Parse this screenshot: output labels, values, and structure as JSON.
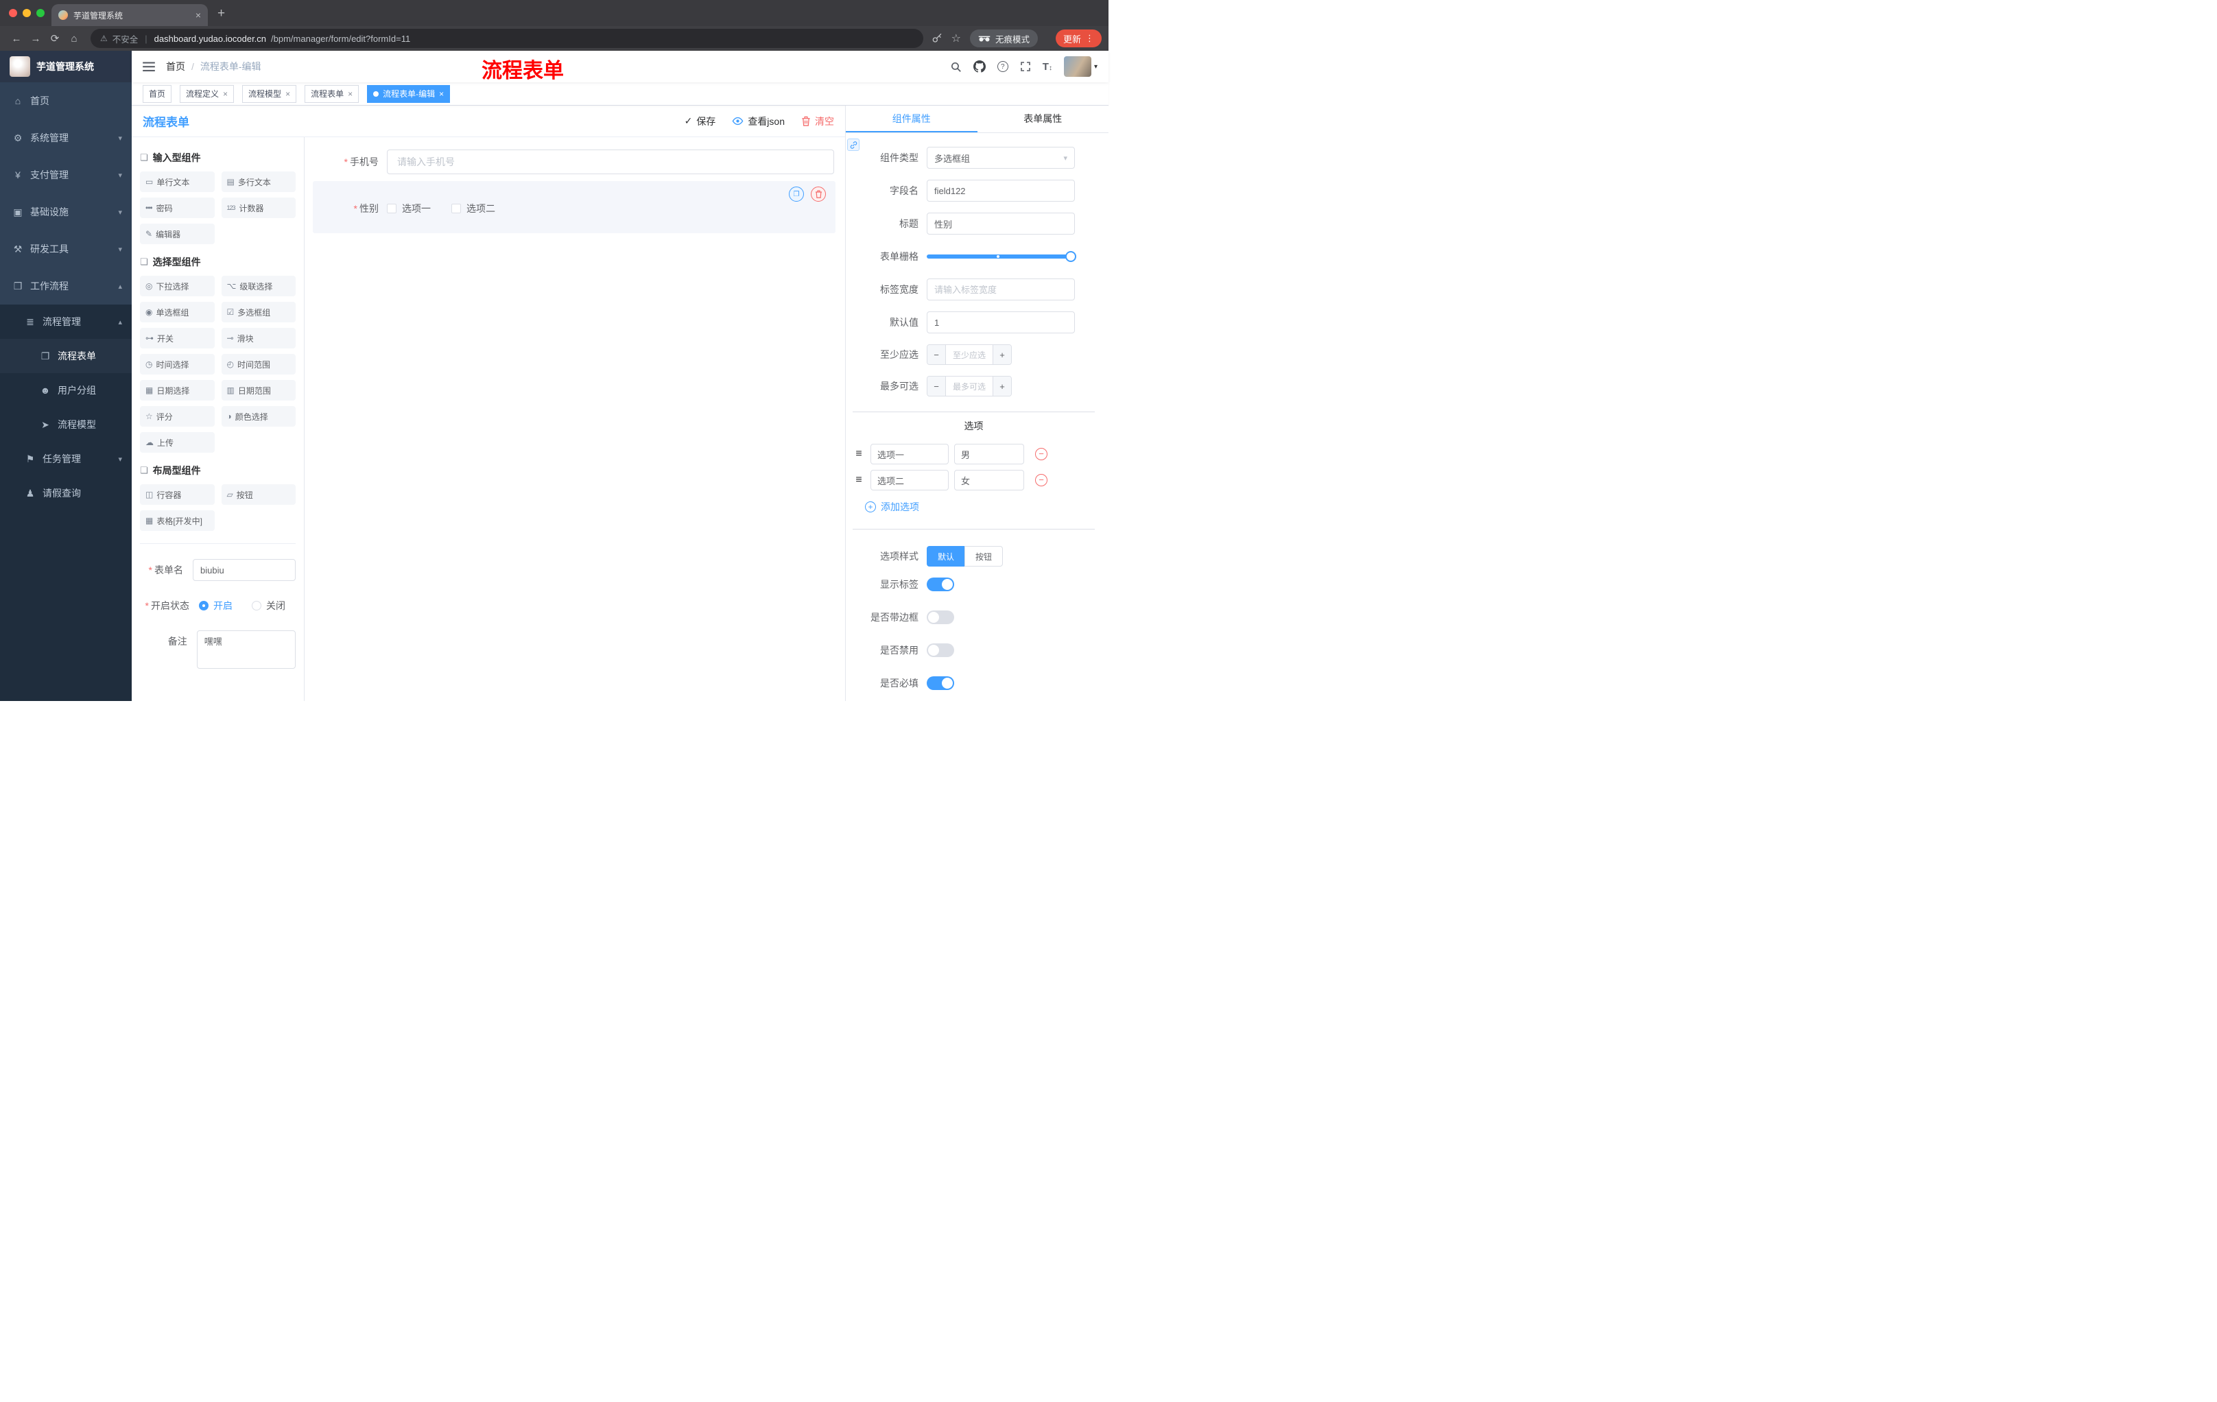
{
  "colors": {
    "accent": "#409eff",
    "danger": "#f56c6c",
    "annotation_red": "#ff0000",
    "update_button": "#e8503f",
    "sidebar_bg": "#304156",
    "sidebar_nested_bg": "#1f2d3d"
  },
  "browser": {
    "tab_title": "芋道管理系统",
    "close_glyph": "×",
    "new_tab": "+",
    "back": "←",
    "forward": "→",
    "reload": "⟳",
    "home": "⌂",
    "warning": "⚠",
    "security_label": "不安全",
    "divider": "|",
    "url_domain": "dashboard.yudao.iocoder.cn",
    "url_path": "/bpm/manager/form/edit?formId=11",
    "star": "☆",
    "incognito_label": "无痕模式",
    "update_label": "更新",
    "menu_dots": "⋮"
  },
  "header": {
    "breadcrumb_home": "首页",
    "breadcrumb_sep": "/",
    "breadcrumb_current": "流程表单-编辑",
    "annotation": "流程表单",
    "help_glyph": "?",
    "font_icon_main": "T",
    "font_icon_arrows": "↕",
    "avatar_caret": "▾"
  },
  "tags": {
    "close": "×",
    "items": [
      {
        "label": "首页"
      },
      {
        "label": "流程定义"
      },
      {
        "label": "流程模型"
      },
      {
        "label": "流程表单"
      },
      {
        "label": "流程表单-编辑"
      }
    ]
  },
  "sidebar": {
    "logo_title": "芋道管理系统",
    "items": [
      {
        "label": "首页",
        "glyph": "⌂"
      },
      {
        "label": "系统管理",
        "glyph": "⚙",
        "arrow": "▾"
      },
      {
        "label": "支付管理",
        "glyph": "¥",
        "arrow": "▾"
      },
      {
        "label": "基础设施",
        "glyph": "▣",
        "arrow": "▾"
      },
      {
        "label": "研发工具",
        "glyph": "⚒",
        "arrow": "▾"
      },
      {
        "label": "工作流程",
        "glyph": "❒",
        "arrow": "▴"
      }
    ],
    "submenu": {
      "process": {
        "label": "流程管理",
        "glyph": "≣",
        "arrow": "▴"
      },
      "children": [
        {
          "label": "流程表单",
          "glyph": "❐"
        },
        {
          "label": "用户分组",
          "glyph": "☻"
        },
        {
          "label": "流程模型",
          "glyph": "➤"
        }
      ],
      "task": {
        "label": "任务管理",
        "glyph": "⚑",
        "arrow": "▾"
      },
      "leave": {
        "label": "请假查询",
        "glyph": "♟"
      }
    }
  },
  "designer": {
    "title": "流程表单",
    "save_icon": "✓",
    "save_label": "保存",
    "view_json_label": "查看json",
    "clear_label": "清空"
  },
  "palette": {
    "group_icon": "❏",
    "groups": [
      {
        "title": "输入型组件",
        "items": [
          {
            "label": "单行文本",
            "glyph": "▭"
          },
          {
            "label": "多行文本",
            "glyph": "▤"
          },
          {
            "label": "密码",
            "glyph": "•••"
          },
          {
            "label": "计数器",
            "glyph": "123"
          },
          {
            "label": "编辑器",
            "glyph": "✎"
          }
        ]
      },
      {
        "title": "选择型组件",
        "items": [
          {
            "label": "下拉选择",
            "glyph": "◎"
          },
          {
            "label": "级联选择",
            "glyph": "⌥"
          },
          {
            "label": "单选框组",
            "glyph": "◉"
          },
          {
            "label": "多选框组",
            "glyph": "☑"
          },
          {
            "label": "开关",
            "glyph": "⊶"
          },
          {
            "label": "滑块",
            "glyph": "⊸"
          },
          {
            "label": "时间选择",
            "glyph": "◷"
          },
          {
            "label": "时间范围",
            "glyph": "◴"
          },
          {
            "label": "日期选择",
            "glyph": "▦"
          },
          {
            "label": "日期范围",
            "glyph": "▥"
          },
          {
            "label": "评分",
            "glyph": "☆"
          },
          {
            "label": "颜色选择",
            "glyph": "◑"
          },
          {
            "label": "上传",
            "glyph": "☁"
          }
        ]
      },
      {
        "title": "布局型组件",
        "items": [
          {
            "label": "行容器",
            "glyph": "◫"
          },
          {
            "label": "按钮",
            "glyph": "▱"
          },
          {
            "label": "表格[开发中]",
            "glyph": "▦"
          }
        ]
      }
    ]
  },
  "form_meta": {
    "required_mark": "*",
    "name_label": "表单名",
    "name_value": "biubiu",
    "status_label": "开启状态",
    "status_on": "开启",
    "status_off": "关闭",
    "remark_label": "备注",
    "remark_value": "嘿嘿"
  },
  "canvas": {
    "phone": {
      "required": "*",
      "label": "手机号",
      "placeholder": "请输入手机号"
    },
    "gender": {
      "required": "*",
      "label": "性别",
      "option1": "选项一",
      "option2": "选项二"
    }
  },
  "props": {
    "tab_component": "组件属性",
    "tab_form": "表单属性",
    "rows": {
      "type_label": "组件类型",
      "type_value": "多选框组",
      "field_label": "字段名",
      "field_value": "field122",
      "title_label": "标题",
      "title_value": "性别",
      "grid_label": "表单栅格",
      "width_label": "标签宽度",
      "width_placeholder": "请输入标签宽度",
      "default_label": "默认值",
      "default_value": "1",
      "min_label": "至少应选",
      "min_placeholder": "至少应选",
      "max_label": "最多可选",
      "max_placeholder": "最多可选"
    },
    "options": {
      "divider_title": "选项",
      "rows": [
        {
          "name": "选项一",
          "value": "男"
        },
        {
          "name": "选项二",
          "value": "女"
        }
      ],
      "add_label": "添加选项"
    },
    "style": {
      "label": "选项样式",
      "default": "默认",
      "button": "按钮"
    },
    "toggles": [
      {
        "label": "显示标签",
        "on": true
      },
      {
        "label": "是否带边框",
        "on": false
      },
      {
        "label": "是否禁用",
        "on": false
      },
      {
        "label": "是否必填",
        "on": true
      }
    ]
  },
  "misc": {
    "minus": "−",
    "plus": "+",
    "add_plus": "+",
    "chevron_down": "▾",
    "copy_glyph": "❐",
    "drag_handle": "≡"
  }
}
